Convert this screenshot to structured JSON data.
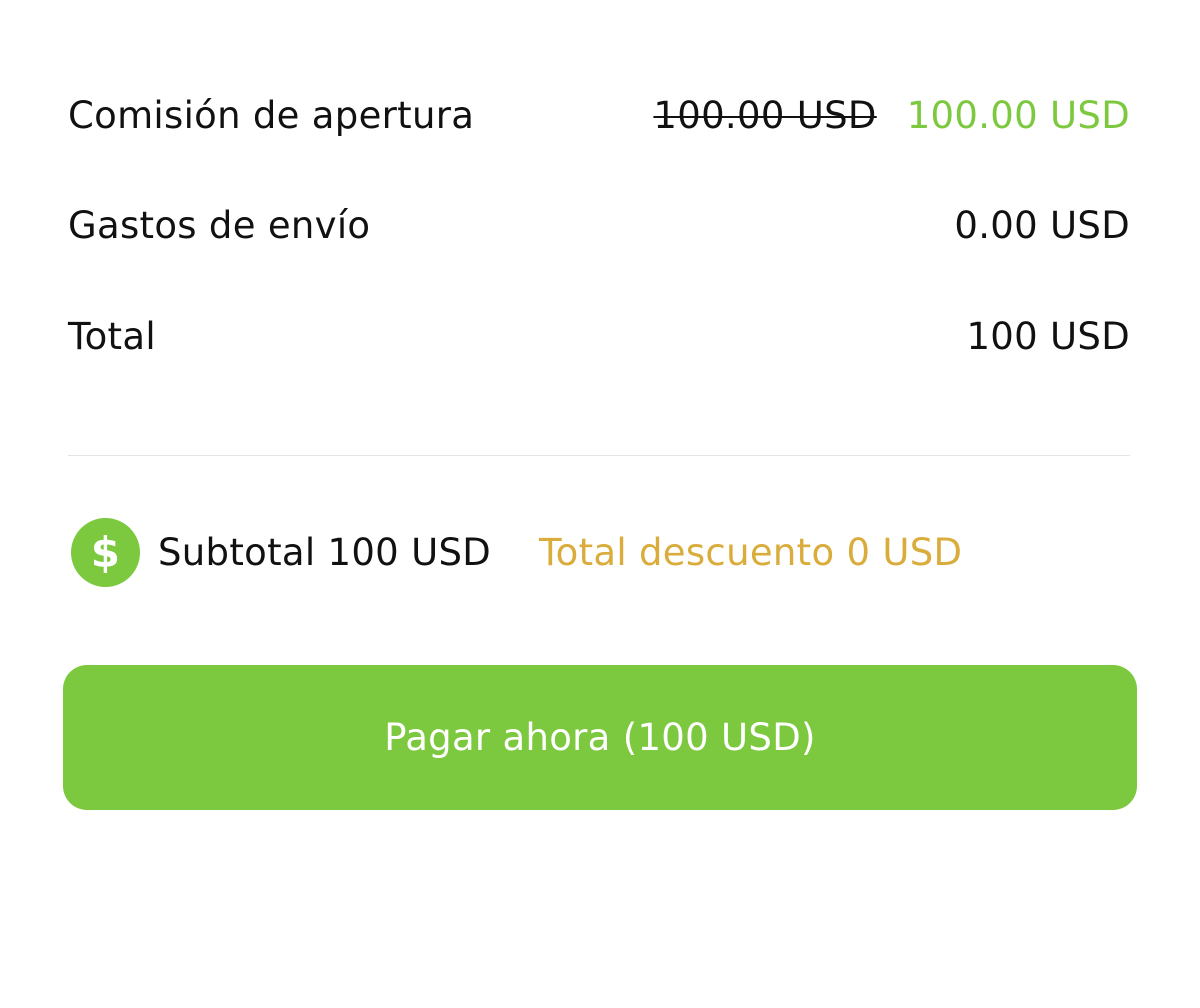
{
  "fees": {
    "opening": {
      "label": "Comisión de apertura",
      "original": "100.00 USD",
      "final": "100.00 USD"
    },
    "shipping": {
      "label": "Gastos de envío",
      "value": "0.00 USD"
    },
    "total": {
      "label": "Total",
      "value": "100 USD"
    }
  },
  "summary": {
    "icon": "dollar-coin-icon",
    "icon_glyph": "$",
    "subtotal": "Subtotal 100 USD",
    "discount": "Total descuento 0 USD"
  },
  "actions": {
    "pay_label": "Pagar ahora (100 USD)"
  },
  "colors": {
    "accent": "#7cc93f",
    "discount": "#d9ac3c",
    "text": "#111111",
    "divider": "#e4e4e4"
  }
}
